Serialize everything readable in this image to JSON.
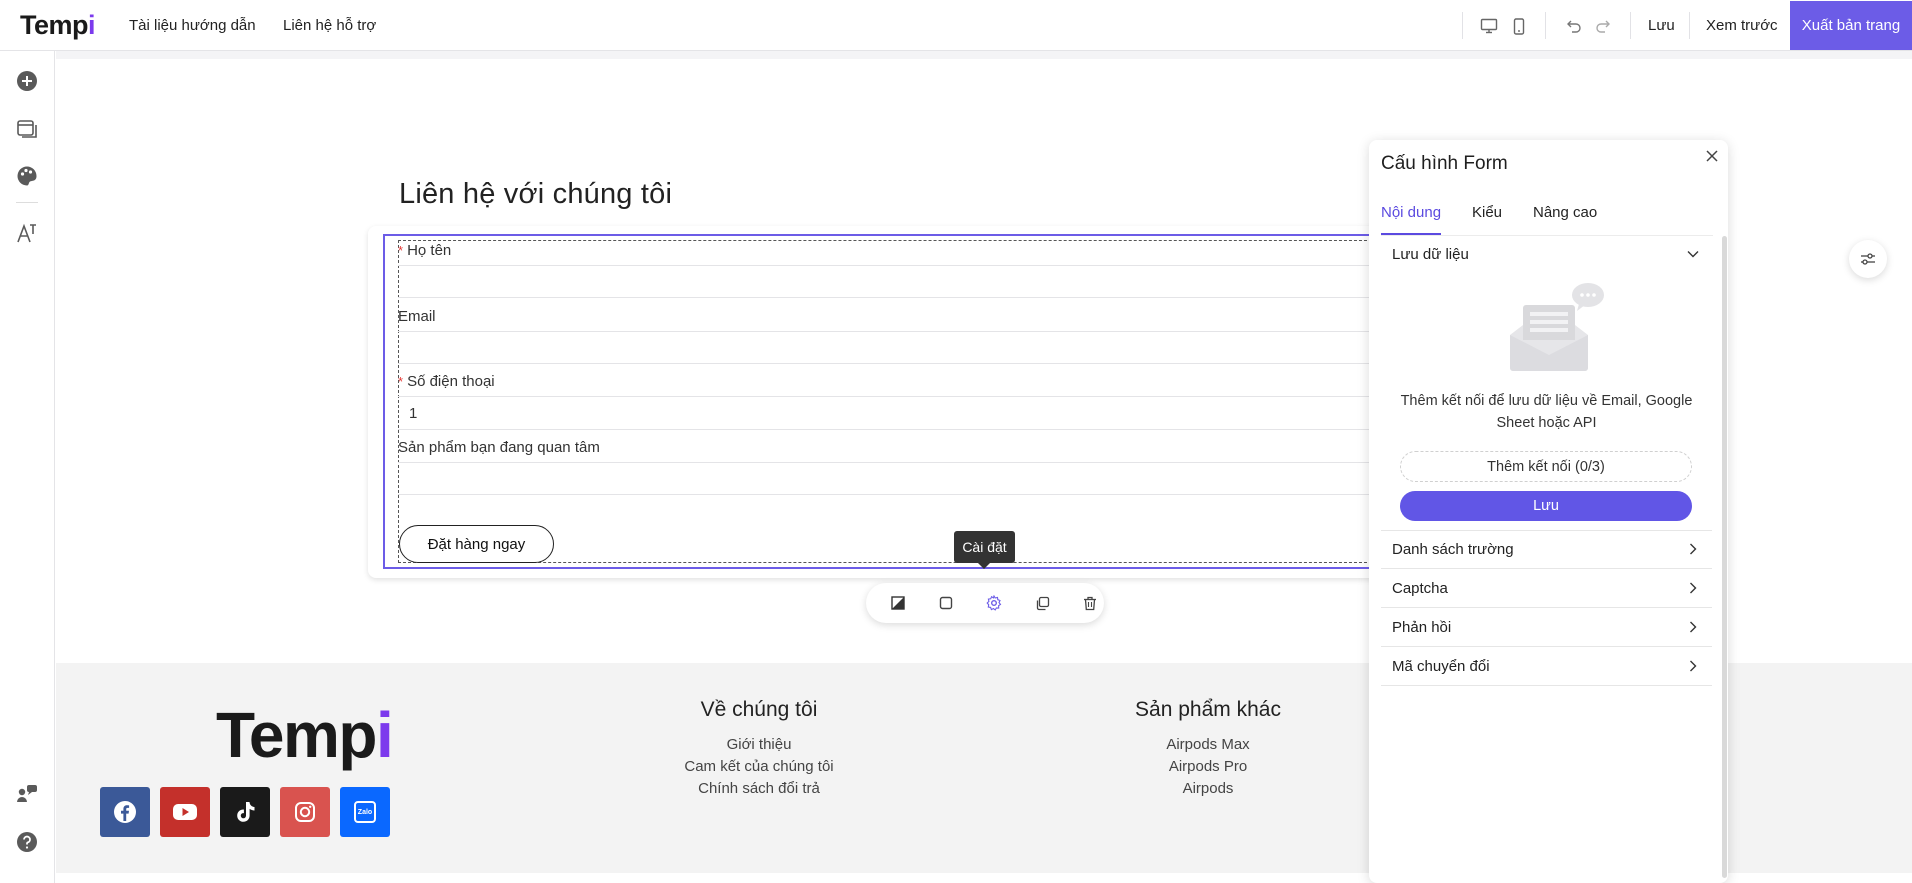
{
  "app": {
    "logo_text": "Temp",
    "logo_accent": "i",
    "brand_color": "#6c5ce7"
  },
  "topbar": {
    "nav": [
      "Tài liệu hướng dẫn",
      "Liên hệ hỗ trợ"
    ],
    "save_label": "Lưu",
    "preview_label": "Xem trước",
    "publish_label": "Xuất bản trang",
    "icons": [
      "desktop-icon",
      "mobile-icon",
      "undo-icon",
      "redo-icon"
    ]
  },
  "sidebar": {
    "icons": [
      "add-icon",
      "pages-icon",
      "palette-icon",
      "typography-icon",
      "community-icon",
      "help-icon"
    ]
  },
  "form": {
    "title": "Liên hệ với chúng tôi",
    "fields": [
      {
        "label": "Họ tên",
        "required": true,
        "value": ""
      },
      {
        "label": "Email",
        "required": false,
        "value": ""
      },
      {
        "label": "Số điện thoại",
        "required": true,
        "value": "1"
      },
      {
        "label": "Sản phẩm bạn đang quan tâm",
        "required": false,
        "value": ""
      }
    ],
    "submit_label": "Đặt hàng ngay",
    "required_mark": "*"
  },
  "tooltip": "Cài đặt",
  "element_toolbar": {
    "icons": [
      "style-icon",
      "border-icon",
      "settings-icon",
      "duplicate-icon",
      "delete-icon"
    ]
  },
  "footer": {
    "logo_text": "Temp",
    "logo_accent": "i",
    "about": {
      "heading": "Về chúng tôi",
      "links": [
        "Giới thiệu",
        "Cam kết của chúng tôi",
        "Chính sách đổi trả"
      ]
    },
    "products": {
      "heading": "Sản phẩm khác",
      "links": [
        "Airpods Max",
        "Airpods Pro",
        "Airpods"
      ]
    },
    "social": [
      {
        "name": "facebook",
        "color": "#3b5998"
      },
      {
        "name": "youtube",
        "color": "#c4302b"
      },
      {
        "name": "tiktok",
        "color": "#1a1a1a"
      },
      {
        "name": "instagram",
        "color": "#d9534f"
      },
      {
        "name": "zalo",
        "color": "#0a68ff",
        "text": "Zalo"
      }
    ]
  },
  "panel": {
    "title": "Cấu hình Form",
    "tabs": [
      "Nội dung",
      "Kiểu",
      "Nâng cao"
    ],
    "active_tab": "Nội dung",
    "data_section": {
      "label": "Lưu dữ liệu",
      "empty_text": "Thêm kết nối để lưu dữ liệu về Email, Google Sheet hoặc API",
      "connect_label": "Thêm kết nối (0/3)",
      "save_label": "Lưu"
    },
    "sections": [
      "Danh sách trường",
      "Captcha",
      "Phản hồi",
      "Mã chuyển đổi"
    ]
  }
}
